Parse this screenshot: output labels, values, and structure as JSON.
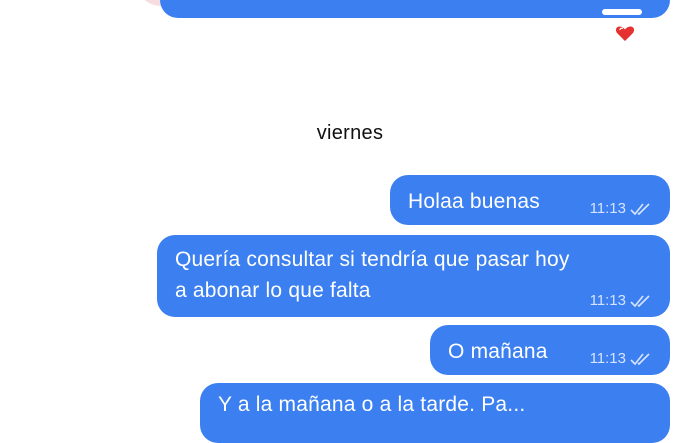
{
  "chat": {
    "day_label": "viernes",
    "reaction": "heart",
    "messages": [
      {
        "text": "Holaa buenas",
        "time": "11:13",
        "status": "read"
      },
      {
        "text_lines": [
          "Quería consultar si tendría que pasar hoy",
          "a abonar lo que falta"
        ],
        "time": "11:13",
        "status": "read"
      },
      {
        "text": "O mañana",
        "time": "11:13",
        "status": "read"
      },
      {
        "text": "Y a la mañana o a la tarde. Pa..."
      }
    ]
  },
  "colors": {
    "bubble": "#3b7ff0",
    "bubble_text": "#ffffff",
    "meta_text": "#d6e4ff",
    "heart": "#e5312f"
  }
}
